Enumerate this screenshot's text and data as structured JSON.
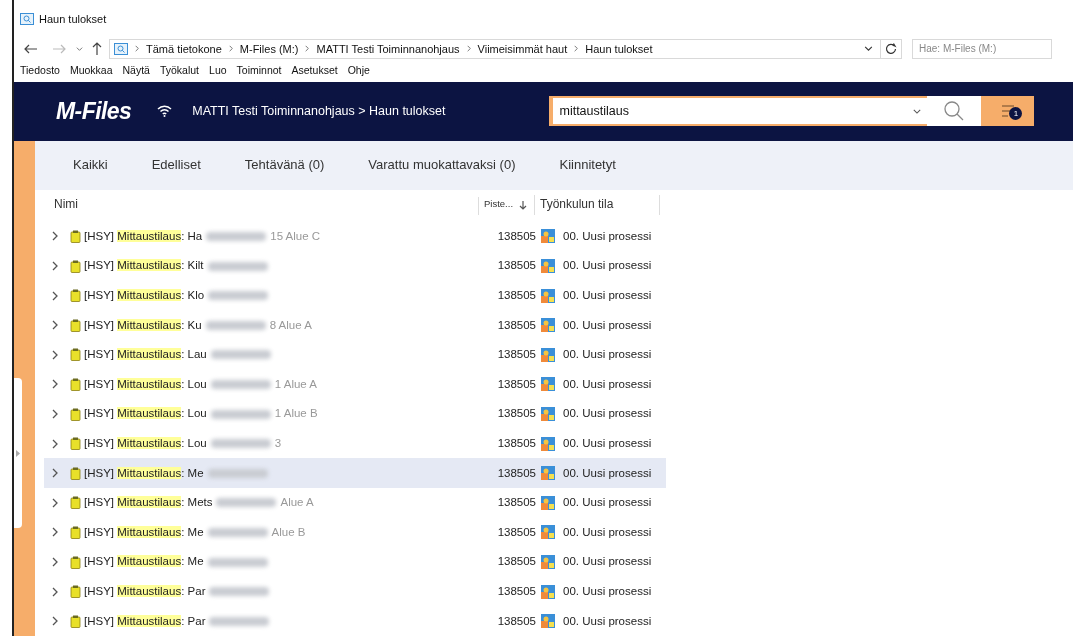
{
  "window": {
    "title": "Haun tulokset"
  },
  "address_bar": {
    "crumbs": [
      "Tämä tietokone",
      "M-Files (M:)",
      "MATTI Testi Toiminnanohjaus",
      "Viimeisimmät haut",
      "Haun tulokset"
    ],
    "search_placeholder": "Hae: M-Files (M:)"
  },
  "menu": [
    "Tiedosto",
    "Muokkaa",
    "Näytä",
    "Työkalut",
    "Luo",
    "Toiminnot",
    "Asetukset",
    "Ohje"
  ],
  "header": {
    "logo": "M-Files",
    "path": "MATTI Testi Toiminnanohjaus > Haun tulokset",
    "search_value": "mittaustilaus",
    "filter_count": "1"
  },
  "tabs": [
    {
      "label": "Kaikki",
      "selected": false
    },
    {
      "label": "Edelliset",
      "selected": false
    },
    {
      "label": "Tehtävänä (0)",
      "selected": false
    },
    {
      "label": "Varattu muokattavaksi (0)",
      "selected": false
    },
    {
      "label": "Kiinnitetyt",
      "selected": false
    }
  ],
  "table": {
    "columns": [
      "Nimi",
      "Piste...",
      "Työnkulun tila"
    ],
    "rows": [
      {
        "prefix": "[HSY]",
        "match": "Mittaustilaus",
        "name_start": ": Ha",
        "name_end": "15 Alue C",
        "score": "138505",
        "state": "00. Uusi prosessi",
        "selected": false
      },
      {
        "prefix": "[HSY]",
        "match": "Mittaustilaus",
        "name_start": ": Kilt",
        "score": "138505",
        "state": "00. Uusi prosessi",
        "selected": false
      },
      {
        "prefix": "[HSY]",
        "match": "Mittaustilaus",
        "name_start": ": Klo",
        "score": "138505",
        "state": "00. Uusi prosessi",
        "selected": false
      },
      {
        "prefix": "[HSY]",
        "match": "Mittaustilaus",
        "name_start": ": Ku",
        "name_end": "8 Alue A",
        "score": "138505",
        "state": "00. Uusi prosessi",
        "selected": false
      },
      {
        "prefix": "[HSY]",
        "match": "Mittaustilaus",
        "name_start": ": Lau",
        "score": "138505",
        "state": "00. Uusi prosessi",
        "selected": false
      },
      {
        "prefix": "[HSY]",
        "match": "Mittaustilaus",
        "name_start": ": Lou",
        "name_end": "1 Alue A",
        "score": "138505",
        "state": "00. Uusi prosessi",
        "selected": false
      },
      {
        "prefix": "[HSY]",
        "match": "Mittaustilaus",
        "name_start": ": Lou",
        "name_end": "1 Alue B",
        "score": "138505",
        "state": "00. Uusi prosessi",
        "selected": false
      },
      {
        "prefix": "[HSY]",
        "match": "Mittaustilaus",
        "name_start": ": Lou",
        "name_end": "3",
        "score": "138505",
        "state": "00. Uusi prosessi",
        "selected": false
      },
      {
        "prefix": "[HSY]",
        "match": "Mittaustilaus",
        "name_start": ": Me",
        "score": "138505",
        "state": "00. Uusi prosessi",
        "selected": true
      },
      {
        "prefix": "[HSY]",
        "match": "Mittaustilaus",
        "name_start": ": Mets",
        "name_end": "Alue A",
        "score": "138505",
        "state": "00. Uusi prosessi",
        "selected": false
      },
      {
        "prefix": "[HSY]",
        "match": "Mittaustilaus",
        "name_start": ": Me",
        "name_end": "Alue B",
        "score": "138505",
        "state": "00. Uusi prosessi",
        "selected": false
      },
      {
        "prefix": "[HSY]",
        "match": "Mittaustilaus",
        "name_start": ": Me",
        "score": "138505",
        "state": "00. Uusi prosessi",
        "selected": false
      },
      {
        "prefix": "[HSY]",
        "match": "Mittaustilaus",
        "name_start": ": Par",
        "score": "138505",
        "state": "00. Uusi prosessi",
        "selected": false
      },
      {
        "prefix": "[HSY]",
        "match": "Mittaustilaus",
        "name_start": ": Par",
        "score": "138505",
        "state": "00. Uusi prosessi",
        "selected": false
      }
    ]
  }
}
